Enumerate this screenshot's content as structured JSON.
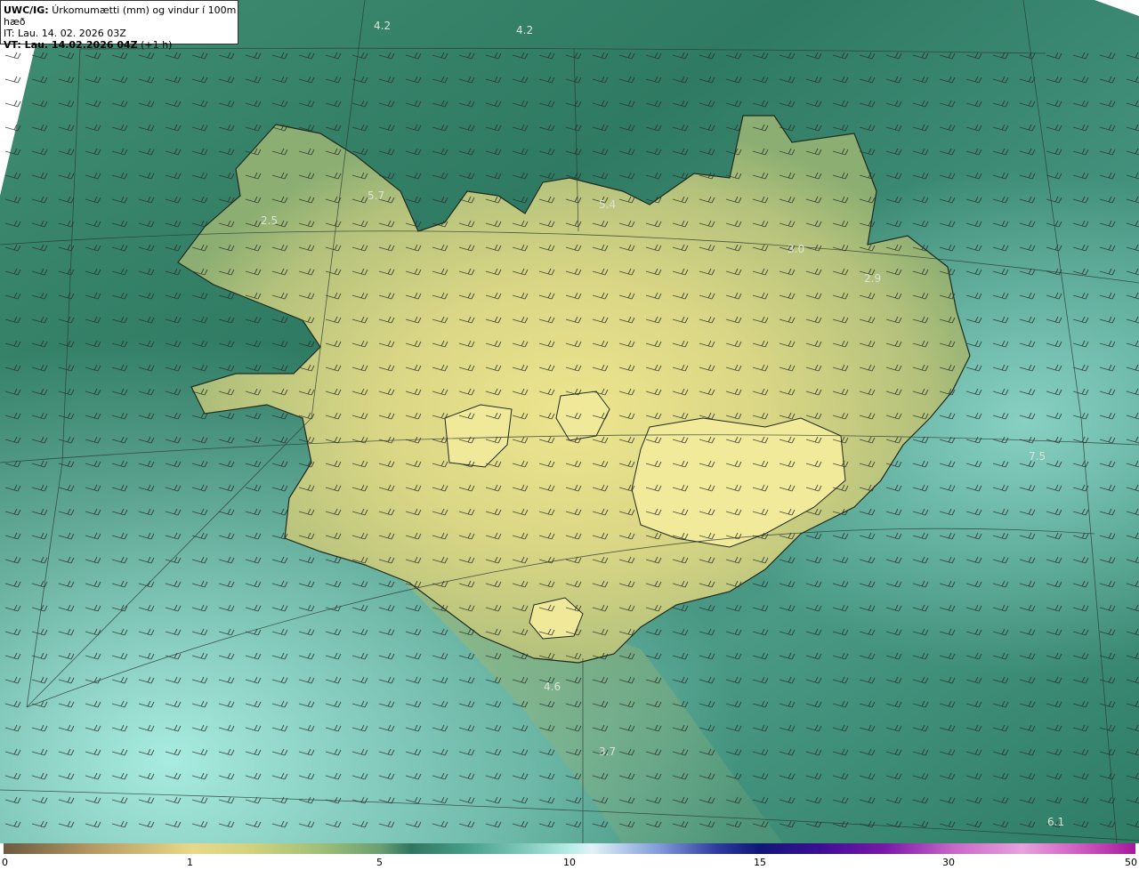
{
  "header": {
    "model": "UWC/IG:",
    "title": "Úrkomumætti (mm) og vindur í 100m hæð",
    "it_line": "IT: Lau. 14. 02. 2026 03Z",
    "vt_bold": "VT: Lau. 14.02.2026 04Z",
    "vt_lead": "(+1 h)"
  },
  "map_labels": [
    {
      "text": "4.2"
    },
    {
      "text": "4.2"
    },
    {
      "text": "5.7"
    },
    {
      "text": "2.5"
    },
    {
      "text": "5.4"
    },
    {
      "text": "3.0"
    },
    {
      "text": "2.9"
    },
    {
      "text": "7.5"
    },
    {
      "text": "4.6"
    },
    {
      "text": "3.7"
    },
    {
      "text": "6.1"
    }
  ],
  "colorbar": {
    "ticks": [
      "0",
      "1",
      "5",
      "10",
      "15",
      "30",
      "50"
    ],
    "colors": [
      "#6b5a42",
      "#e8d98a",
      "#2f7660",
      "#b7ece6",
      "#101777",
      "#e8a2dd",
      "#a6189b"
    ]
  },
  "colors": {
    "sea_dark": "#2f7660",
    "sea_light": "#8fd2c4",
    "land_yellow": "#e6e290",
    "coast": "#1e2a1e"
  }
}
